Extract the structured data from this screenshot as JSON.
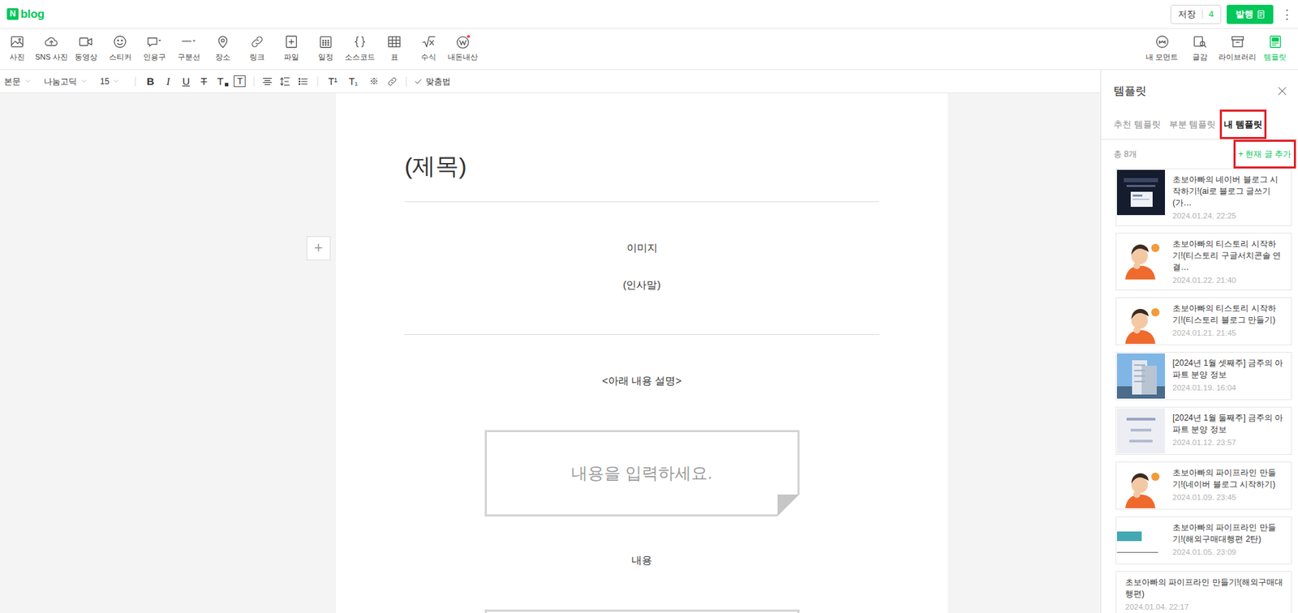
{
  "logo": {
    "mark": "N",
    "name": "blog"
  },
  "header": {
    "save_label": "저장",
    "save_count": "4",
    "publish_label": "발행",
    "more": "⋮"
  },
  "toolbar": {
    "items": [
      {
        "label": "사진",
        "badge": false
      },
      {
        "label": "SNS 사진",
        "badge": false
      },
      {
        "label": "동영상",
        "badge": false
      },
      {
        "label": "스티커",
        "badge": false
      },
      {
        "label": "인용구",
        "badge": false
      },
      {
        "label": "구분선",
        "badge": false
      },
      {
        "label": "장소",
        "badge": false
      },
      {
        "label": "링크",
        "badge": false
      },
      {
        "label": "파일",
        "badge": false
      },
      {
        "label": "일정",
        "badge": false
      },
      {
        "label": "소스코드",
        "badge": false
      },
      {
        "label": "표",
        "badge": false
      },
      {
        "label": "수식",
        "badge": false
      },
      {
        "label": "내돈내산",
        "badge": true
      }
    ],
    "right": [
      {
        "label": "내 모먼트",
        "selected": false
      },
      {
        "label": "글감",
        "selected": false
      },
      {
        "label": "라이브러리",
        "selected": false
      },
      {
        "label": "템플릿",
        "selected": true
      }
    ]
  },
  "format_bar": {
    "dropdowns": [
      "본문",
      "나눔고딕",
      "15"
    ],
    "buttons": [
      {
        "glyph": "B",
        "kind": "bold"
      },
      {
        "glyph": "I",
        "kind": "italic"
      },
      {
        "glyph": "U",
        "kind": "underline"
      },
      {
        "glyph": "T",
        "kind": "strike"
      },
      {
        "glyph": "T",
        "kind": "color"
      },
      {
        "glyph": "T",
        "kind": "background"
      }
    ],
    "script_buttons": [
      {
        "glyph": "T¹",
        "kind": "sup"
      },
      {
        "glyph": "T₁",
        "kind": "sub"
      },
      {
        "glyph": "※",
        "kind": "symbol"
      }
    ],
    "spellcheck": "맞춤법"
  },
  "editor": {
    "add_button": "+",
    "title": "(제목)",
    "blocks": [
      {
        "kind": "divider"
      },
      {
        "kind": "text",
        "text": "이미지"
      },
      {
        "kind": "text",
        "text": "(인사말)"
      },
      {
        "kind": "divider"
      },
      {
        "kind": "text",
        "text": "<아래 내용 설명>"
      },
      {
        "kind": "quote",
        "text": "내용을 입력하세요."
      },
      {
        "kind": "text",
        "text": "내용"
      },
      {
        "kind": "quote"
      }
    ]
  },
  "template_panel": {
    "title": "템플릿",
    "tabs": [
      {
        "label": "추천 템플릿",
        "selected": false,
        "annotated": false
      },
      {
        "label": "부분 템플릿",
        "selected": false,
        "annotated": false
      },
      {
        "label": "내 템플릿",
        "selected": true,
        "annotated": true
      }
    ],
    "count": "총 8개",
    "add_current": {
      "label": "+ 현재 글 추가",
      "annotated": true
    },
    "items": [
      {
        "title": "초보아빠의 네이버 블로그 시작하기!(ai로 블로그 글쓰기(가…",
        "date": "2024.01.24. 22:25",
        "thumbnail": "screenshot"
      },
      {
        "title": "초보아빠의 티스토리 시작하기!(티스토리 구글서치콘솔 연결…",
        "date": "2024.01.22. 21:40",
        "thumbnail": "cartoon"
      },
      {
        "title": "초보아빠의 티스토리 시작하기!(티스토리 블로그 만들기)",
        "date": "2024.01.21. 21:45",
        "thumbnail": "cartoon"
      },
      {
        "title": "[2024년 1월 셋째주] 금주의 아파트 분양 정보",
        "date": "2024.01.19. 16:04",
        "thumbnail": "building"
      },
      {
        "title": "[2024년 1월 둘째주] 금주의 아파트 분양 정보",
        "date": "2024.01.12. 23:57",
        "thumbnail": "text-card"
      },
      {
        "title": "초보아빠의 파이프라인 만들기!(네이버 블로그 시작하기)",
        "date": "2024.01.09. 23:45",
        "thumbnail": "cartoon"
      },
      {
        "title": "초보아빠의 파이프라인 만들기!(해외구매대행편 2탄)",
        "date": "2024.01.05. 23:09",
        "thumbnail": "label-card"
      },
      {
        "title": "초보아빠의 파이프라인 만들기!(해외구매대행편)",
        "date": "2024.01.04. 22:17",
        "thumbnail": "none"
      }
    ]
  }
}
